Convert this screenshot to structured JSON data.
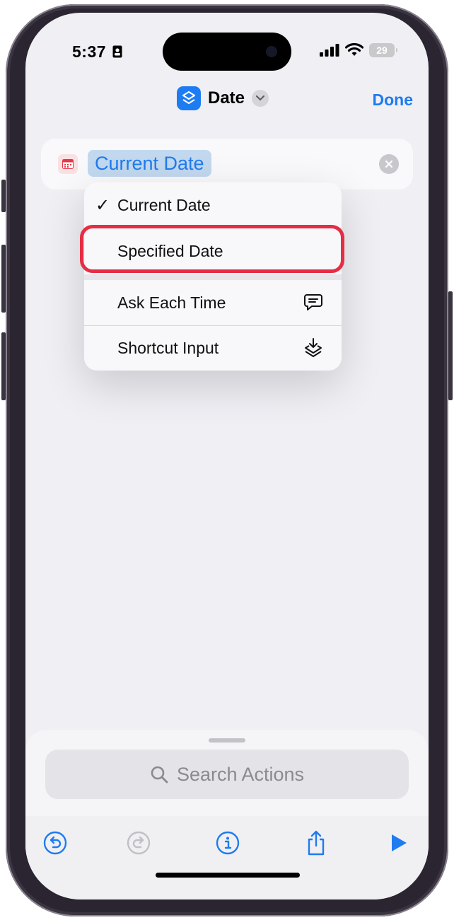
{
  "status": {
    "time": "5:37",
    "battery": "29"
  },
  "nav": {
    "title": "Date",
    "done_label": "Done"
  },
  "action": {
    "token_label": "Current Date"
  },
  "menu": {
    "items": [
      {
        "label": "Current Date",
        "checked": true,
        "icon": "checkmark-icon"
      },
      {
        "label": "Specified Date",
        "checked": false,
        "highlighted": true
      },
      {
        "label": "Ask Each Time",
        "checked": false,
        "icon": "message-bubble-icon"
      },
      {
        "label": "Shortcut Input",
        "checked": false,
        "icon": "shortcut-input-icon"
      }
    ],
    "check_glyph": "✓"
  },
  "sheet": {
    "search_placeholder": "Search Actions"
  },
  "toolbar": {
    "icons": [
      "undo-icon",
      "redo-icon",
      "info-icon",
      "share-icon",
      "play-icon"
    ]
  },
  "colors": {
    "accent": "#1f7bef",
    "highlight": "#e52d45",
    "background": "#efeff4"
  }
}
